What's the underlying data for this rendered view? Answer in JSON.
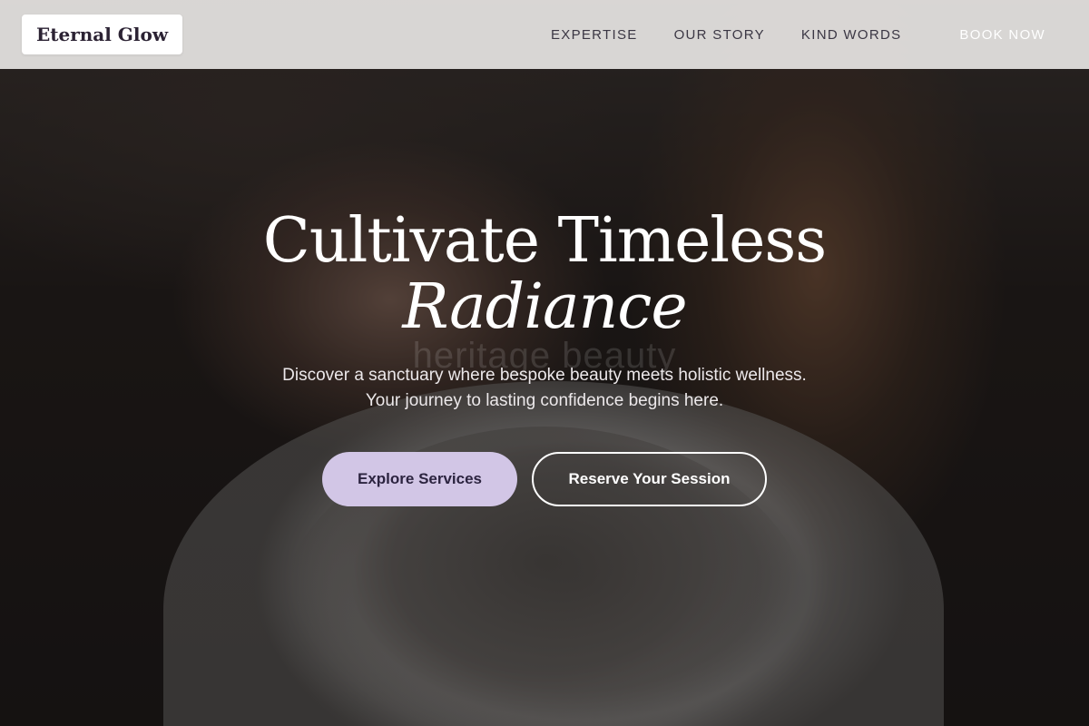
{
  "header": {
    "logo_text": "Eternal Glow",
    "nav_items": [
      {
        "label": "EXPERTISE"
      },
      {
        "label": "OUR STORY"
      },
      {
        "label": "KIND WORDS"
      }
    ],
    "book_label": "BOOK NOW"
  },
  "hero": {
    "headline_line1": "Cultivate Timeless",
    "headline_line2": "Radiance",
    "watermark": "heritage beauty",
    "subtext_line1": "Discover a sanctuary where bespoke beauty meets holistic wellness.",
    "subtext_line2": "Your journey to lasting confidence begins here.",
    "primary_cta": "Explore Services",
    "secondary_cta": "Reserve Your Session"
  },
  "colors": {
    "primary_button": "#d2c6e6",
    "header_bg": "#e6e4e2"
  }
}
